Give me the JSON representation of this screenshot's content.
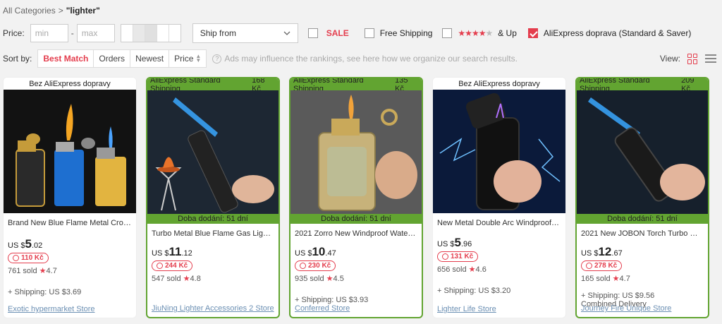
{
  "breadcrumb": {
    "root": "All Categories",
    "separator": ">",
    "query": "\"lighter\""
  },
  "filters": {
    "price_label": "Price:",
    "min_placeholder": "min",
    "max_placeholder": "max",
    "dash": "-",
    "ship_from": "Ship from",
    "sale": "SALE",
    "free_shipping": "Free Shipping",
    "stars_full": "★★★★",
    "stars_empty": "★",
    "and_up": "& Up",
    "aliexpress_doprava": "AliExpress doprava (Standard & Saver)"
  },
  "sort": {
    "label": "Sort by:",
    "options": [
      "Best Match",
      "Orders",
      "Newest",
      "Price"
    ],
    "note": "Ads may influence the rankings, see here how we organize our search results.",
    "view_label": "View:"
  },
  "products": [
    {
      "top": "Bez AliExpress dopravy",
      "top_price": "",
      "delivery": "",
      "title": "Brand New Blue Flame Metal Croc…",
      "currency": "US $",
      "price_int": "5",
      "price_dec": ".02",
      "czk": "110 Kč",
      "sold": "761 sold",
      "rating": "4.7",
      "shipping": "+ Shipping: US $3.69",
      "combined": "",
      "store": "Exotic hypermarket Store"
    },
    {
      "top": "AliExpress Standard Shipping",
      "top_price": "168 Kč",
      "delivery": "Doba dodání: 51 dní",
      "title": "Turbo Metal Blue Flame Gas Light…",
      "currency": "US $",
      "price_int": "11",
      "price_dec": ".12",
      "czk": "244 Kč",
      "sold": "547 sold",
      "rating": "4.8",
      "shipping": "",
      "combined": "",
      "store": "JiuNing Lighter Accessories 2 Store"
    },
    {
      "top": "AliExpress Standard Shipping",
      "top_price": "135 Kč",
      "delivery": "Doba dodání: 51 dní",
      "title": "2021 Zorro New Windproof Water…",
      "currency": "US $",
      "price_int": "10",
      "price_dec": ".47",
      "czk": "230 Kč",
      "sold": "935 sold",
      "rating": "4.5",
      "shipping": "+ Shipping: US $3.93",
      "combined": "",
      "store": "Conferred Store"
    },
    {
      "top": "Bez AliExpress dopravy",
      "top_price": "",
      "delivery": "",
      "title": "New Metal Double Arc Windproof …",
      "currency": "US $",
      "price_int": "5",
      "price_dec": ".96",
      "czk": "131 Kč",
      "sold": "656 sold",
      "rating": "4.6",
      "shipping": "+ Shipping: US $3.20",
      "combined": "",
      "store": "Lighter Life Store"
    },
    {
      "top": "AliExpress Standard Shipping",
      "top_price": "209 Kč",
      "delivery": "Doba dodání: 51 dní",
      "title": "2021 New JOBON Torch Turbo Wi…",
      "currency": "US $",
      "price_int": "12",
      "price_dec": ".67",
      "czk": "278 Kč",
      "sold": "165 sold",
      "rating": "4.7",
      "shipping": "+ Shipping: US $9.56",
      "combined": "Combined Delivery",
      "store": "Journey Fire Unique Store"
    }
  ],
  "colors": {
    "accent": "#e43d4d",
    "green": "#62a431",
    "link": "#6b8fb3"
  }
}
